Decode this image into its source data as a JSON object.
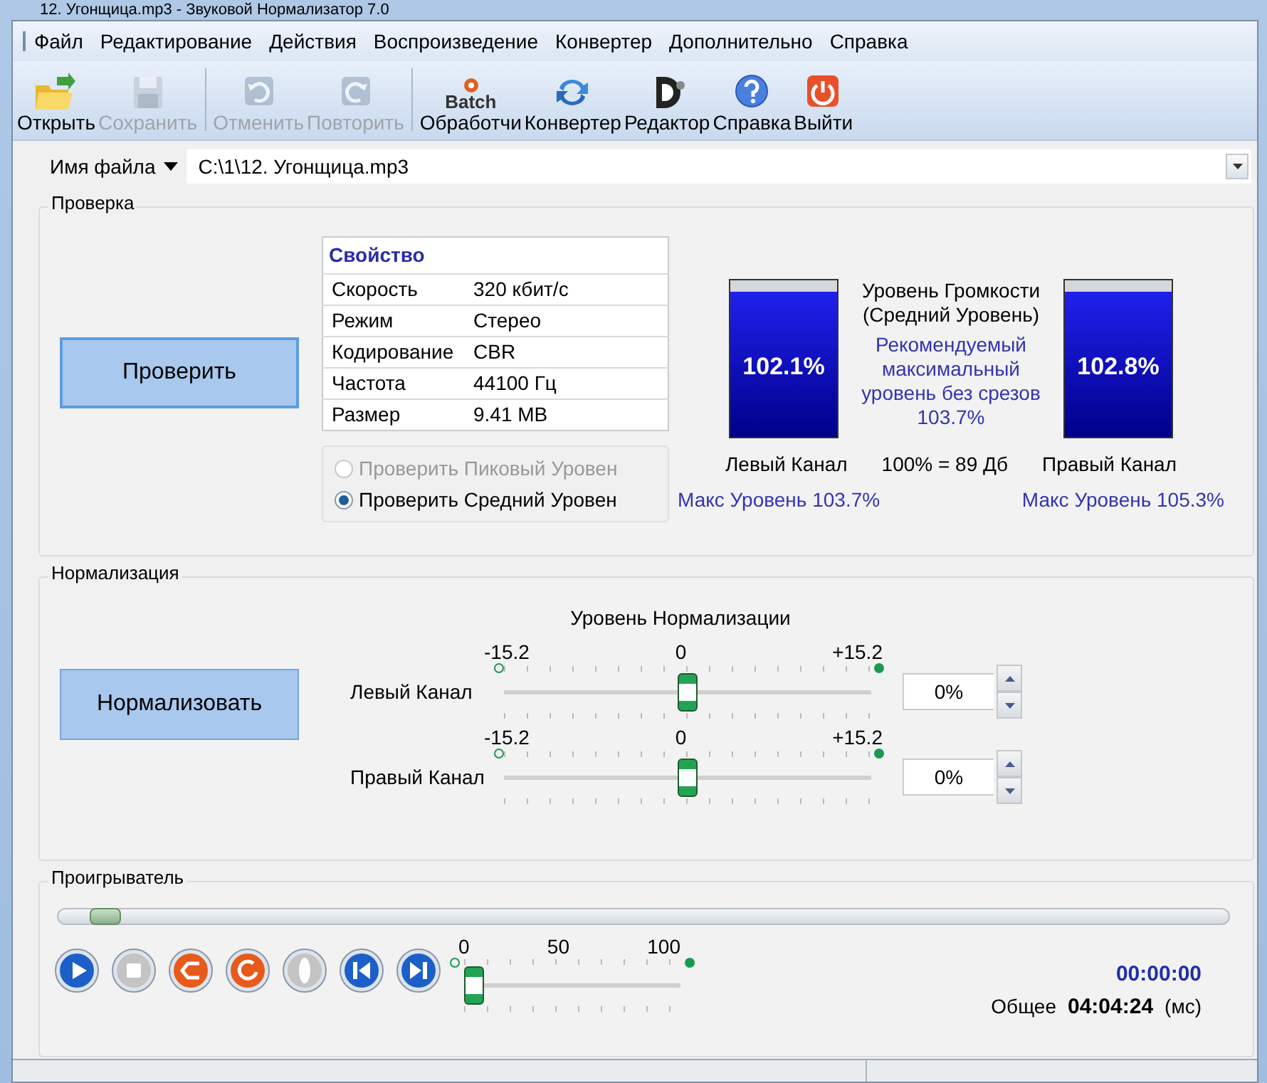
{
  "window": {
    "title": "12. Угонщица.mp3 - Звуковой Нормализатор 7.0"
  },
  "menu": [
    "Файл",
    "Редактирование",
    "Действия",
    "Воспроизведение",
    "Конвертер",
    "Дополнительно",
    "Справка"
  ],
  "toolbar": [
    {
      "kind": "button",
      "label": "Открыть",
      "disabled": false
    },
    {
      "kind": "button",
      "label": "Сохранить",
      "disabled": true
    },
    {
      "kind": "separator"
    },
    {
      "kind": "button",
      "label": "Отменить",
      "disabled": true
    },
    {
      "kind": "button",
      "label": "Повторить",
      "disabled": true
    },
    {
      "kind": "separator"
    },
    {
      "kind": "button",
      "icon_text": "Batch",
      "label": "Обработчи",
      "disabled": false
    },
    {
      "kind": "button",
      "label": "Конвертер",
      "disabled": false
    },
    {
      "kind": "button",
      "label": "Редактор",
      "disabled": false
    },
    {
      "kind": "button",
      "label": "Справка",
      "disabled": false
    },
    {
      "kind": "button",
      "label": "Выйти",
      "disabled": false
    }
  ],
  "file": {
    "label": "Имя файла",
    "value": "C:\\1\\12. Угонщица.mp3"
  },
  "check": {
    "title": "Проверка",
    "button": "Проверить",
    "properties": {
      "header": "Свойство",
      "rows": [
        [
          "Скорость",
          "320 кбит/с"
        ],
        [
          "Режим",
          "Стерео"
        ],
        [
          "Кодирование",
          "CBR"
        ],
        [
          "Частота",
          "44100 Гц"
        ],
        [
          "Размер",
          "9.41 MB"
        ]
      ]
    },
    "radios": [
      {
        "label": "Проверить Пиковый Уровен",
        "checked": false,
        "disabled": true
      },
      {
        "label": "Проверить Средний Уровен",
        "checked": true,
        "disabled": false
      }
    ],
    "meters": [
      {
        "value": "102.1%",
        "level": 0.93,
        "caption": "Левый Канал",
        "max": "Макс Уровень 103.7%"
      },
      {
        "value": "102.8%",
        "level": 0.93,
        "caption": "Правый Канал",
        "max": "Макс Уровень 105.3%"
      }
    ],
    "center_title": [
      "Уровень Громкости",
      "(Средний Уровень)"
    ],
    "recommended": [
      "Рекомендуемый",
      "максимальный",
      "уровень без срезов",
      "103.7%"
    ],
    "scale": "100% = 89 Дб"
  },
  "normalize": {
    "title": "Нормализация",
    "button": "Нормализовать",
    "slider_title": "Уровень Нормализации",
    "channels": [
      {
        "label": "Левый Канал",
        "min": "-15.2",
        "mid": "0",
        "max": "+15.2",
        "level": 0.5,
        "value": "0%"
      },
      {
        "label": "Правый Канал",
        "min": "-15.2",
        "mid": "0",
        "max": "+15.2",
        "level": 0.5,
        "value": "0%"
      }
    ]
  },
  "player": {
    "title": "Проигрыватель",
    "seek": {
      "level": 0.04
    },
    "buttons": [
      {
        "disabled": false
      },
      {
        "disabled": true
      },
      {
        "disabled": false
      },
      {
        "disabled": false
      },
      {
        "disabled": true
      },
      {
        "disabled": false
      },
      {
        "disabled": false
      }
    ],
    "volume": {
      "ticks": [
        "0",
        "50",
        "100"
      ],
      "level": 0
    },
    "time": "00:00:00",
    "total_label": "Общее",
    "total": "04:04:24",
    "unit": "(мс)"
  }
}
